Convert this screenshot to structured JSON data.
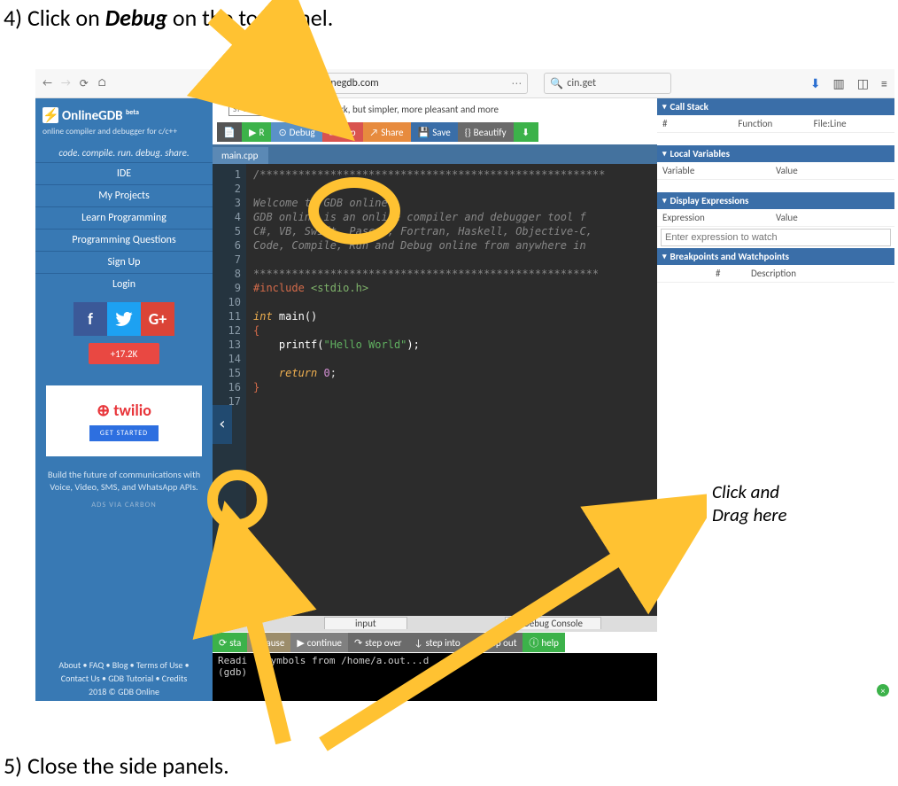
{
  "instructions": {
    "step4_prefix": "4) Click on ",
    "step4_bold": "Debug",
    "step4_suffix": " on the top panel.",
    "step5": "5) Close the side panels."
  },
  "browser": {
    "url_host": "www.onlinegdb.com",
    "url_prefix": "http",
    "search_placeholder": "cin.get"
  },
  "sidebar": {
    "title": "OnlineGDB",
    "beta": "beta",
    "subtitle": "online compiler and debugger for c/c++",
    "tagline": "code. compile. run. debug. share.",
    "links": [
      "IDE",
      "My Projects",
      "Learn Programming",
      "Programming Questions",
      "Sign Up",
      "Login"
    ],
    "plus_count": "17.2K",
    "ad_brand": "twilio",
    "ad_cta": "GET STARTED",
    "ad_text": "Build the future of communications with Voice, Video, SMS, and WhatsApp APIs.",
    "ads_via": "ADS VIA CARBON",
    "footer1": "About • FAQ • Blog • Terms of Use •",
    "footer2": "Contact Us • GDB Tutorial • Credits",
    "footer3": "2018 © GDB Online"
  },
  "sponsor": {
    "tag": "SPONSOR",
    "text_bold": "Slack",
    "text_rest": "mwork, but simpler, more pleasant and more"
  },
  "toolbar": {
    "run": "R",
    "debug": "Debug",
    "stop": "Stop",
    "share": "Share",
    "save": "Save",
    "beautify": "Beautify"
  },
  "tabs": {
    "file": "main.cpp"
  },
  "code_lines": [
    {
      "n": 1,
      "cls": "c-cmt",
      "t": "/******************************************************"
    },
    {
      "n": 2,
      "cls": "",
      "t": ""
    },
    {
      "n": 3,
      "cls": "c-cmt",
      "t": "Welcome to GDB online."
    },
    {
      "n": 4,
      "cls": "c-cmt",
      "t": "GDB online is an online compiler and debugger tool f"
    },
    {
      "n": 5,
      "cls": "c-cmt",
      "t": "C#, VB, Swift, Pascal, Fortran, Haskell, Objective-C,"
    },
    {
      "n": 6,
      "cls": "c-cmt",
      "t": "Code, Compile, Run and Debug online from anywhere in"
    },
    {
      "n": 7,
      "cls": "",
      "t": ""
    },
    {
      "n": 8,
      "cls": "c-cmt",
      "t": "******************************************************"
    },
    {
      "n": 9,
      "cls": "",
      "t": "<span class='c-pre'>#include</span> <span class='c-inc'>&lt;stdio.h&gt;</span>"
    },
    {
      "n": 10,
      "cls": "",
      "t": ""
    },
    {
      "n": 11,
      "cls": "",
      "t": "<span class='c-kw'>int</span> <span class='c-fn'>main()</span>"
    },
    {
      "n": 12,
      "cls": "",
      "t": "<span class='c-brace'>{</span>"
    },
    {
      "n": 13,
      "cls": "",
      "t": "    <span class='c-fn'>printf(</span><span class='c-str'>\"Hello World\"</span><span class='c-fn'>);</span>"
    },
    {
      "n": 14,
      "cls": "",
      "t": ""
    },
    {
      "n": 15,
      "cls": "",
      "t": "    <span class='c-kw'>return</span> <span class='c-num'>0</span>;"
    },
    {
      "n": 16,
      "cls": "",
      "t": "<span class='c-brace'>}</span>"
    },
    {
      "n": 17,
      "cls": "",
      "t": ""
    }
  ],
  "bottom_tabs": {
    "input": "input",
    "dbg": "Debug Console"
  },
  "dbgbar": {
    "start": "sta",
    "pause": "pause",
    "cont": "continue",
    "over": "step over",
    "into": "step into",
    "out": "step out",
    "help": "help"
  },
  "console_text": "Readi   symbols from /home/a.out...d   e.\n(gdb) ",
  "right": {
    "callstack": "Call Stack",
    "cs_hash": "#",
    "cs_fn": "Function",
    "cs_fl": "File:Line",
    "locals": "Local Variables",
    "lv_var": "Variable",
    "lv_val": "Value",
    "display": "Display Expressions",
    "de_ex": "Expression",
    "de_val": "Value",
    "expr_ph": "Enter expression to watch",
    "breaks": "Breakpoints and Watchpoints",
    "bk_hash": "#",
    "bk_desc": "Description"
  },
  "annotations": {
    "drag_note": "Click and\nDrag here"
  }
}
